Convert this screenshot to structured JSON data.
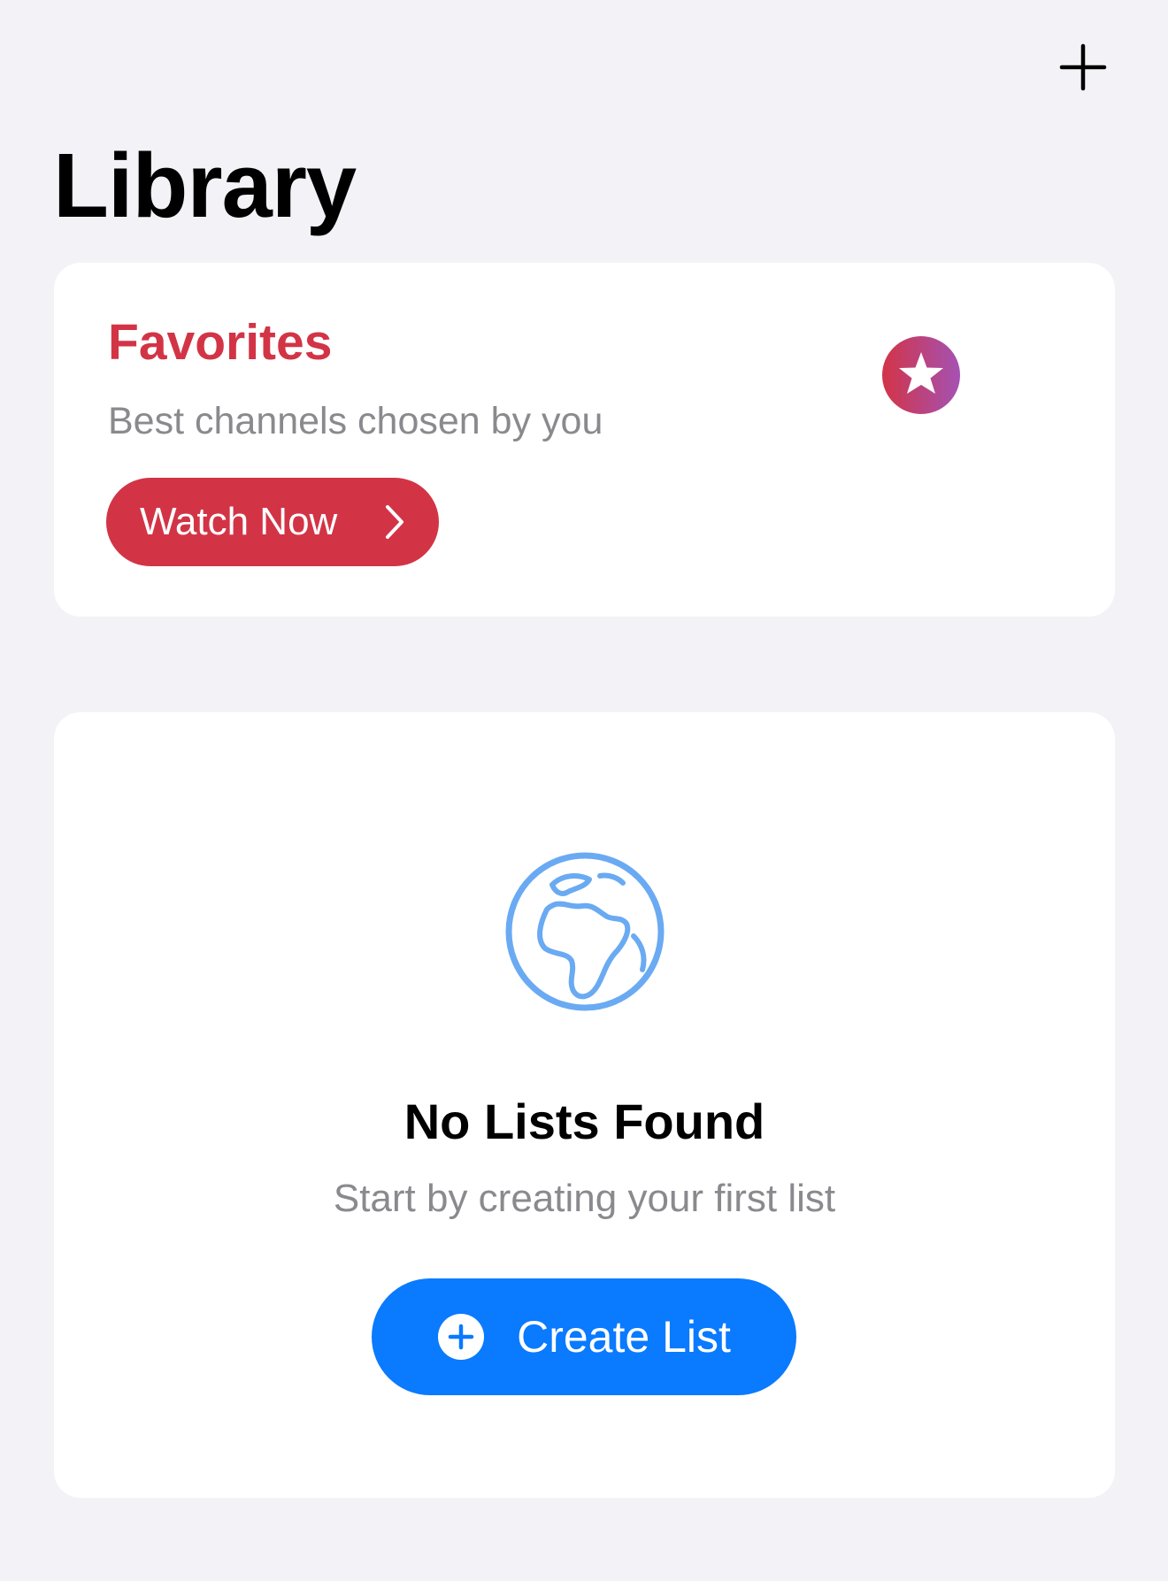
{
  "header": {
    "add_icon": "plus-icon",
    "title": "Library"
  },
  "favorites": {
    "title": "Favorites",
    "subtitle": "Best channels chosen by you",
    "button_label": "Watch Now",
    "button_icon": "chevron-right-icon",
    "graphic_icon": "star-list-icon"
  },
  "lists": {
    "icon": "globe-icon",
    "empty_title": "No Lists Found",
    "empty_subtitle": "Start by creating your first list",
    "button_label": "Create List",
    "button_icon": "plus-circle-icon"
  },
  "colors": {
    "background": "#f2f2f7",
    "card": "#ffffff",
    "accent_red": "#d23446",
    "accent_purple": "#a452b4",
    "accent_blue": "#0a7aff",
    "globe_blue": "#6aaaf2",
    "secondary_text": "#8a8a8e"
  }
}
